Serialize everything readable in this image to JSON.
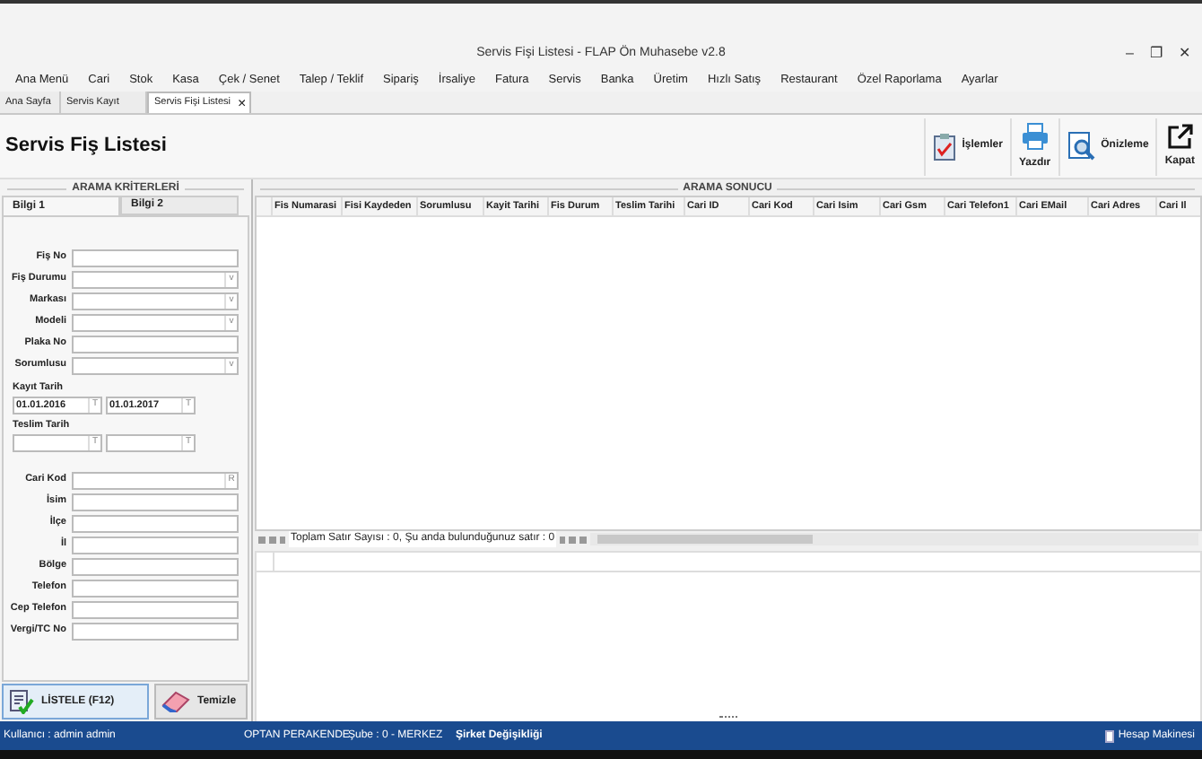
{
  "window": {
    "title": "Servis Fişi Listesi - FLAP Ön Muhasebe v2.8",
    "controls": [
      "–",
      "❐",
      "✕"
    ]
  },
  "menu": [
    "Ana Menü",
    "Cari",
    "Stok",
    "Kasa",
    "Çek / Senet",
    "Talep / Teklif",
    "Sipariş",
    "İrsaliye",
    "Fatura",
    "Servis",
    "Banka",
    "Üretim",
    "Hızlı Satış",
    "Restaurant",
    "Özel Raporlama",
    "Ayarlar"
  ],
  "tabs": [
    {
      "label": "Ana Sayfa",
      "selected": false
    },
    {
      "label": "Servis Kayıt",
      "selected": false
    },
    {
      "label": "Servis Fişi Listesi",
      "selected": true,
      "close": "×"
    }
  ],
  "page_title": "Servis Fiş Listesi",
  "toolbar": [
    {
      "kind": "side",
      "label": "İşlemler"
    },
    {
      "kind": "below",
      "label": "Yazdır"
    },
    {
      "kind": "side",
      "label": "Önizleme"
    },
    {
      "kind": "below",
      "label": "Kapat"
    }
  ],
  "criteria": {
    "title": "ARAMA KRİTERLERİ",
    "tabs": [
      {
        "label": "Bilgi 1",
        "selected": true
      },
      {
        "label": "Bilgi 2",
        "selected": false
      }
    ],
    "fields": [
      {
        "label": "Fiş No"
      },
      {
        "label": "Fiş Durumu",
        "button": "v"
      },
      {
        "label": "Markası",
        "button": "v"
      },
      {
        "label": "Modeli",
        "button": "v"
      },
      {
        "label": "Plaka No"
      },
      {
        "label": "Sorumlusu",
        "button": "v"
      }
    ],
    "date_groups": [
      {
        "label": "Kayıt Tarih",
        "dates": [
          {
            "value": "01.01.2016",
            "button": "T"
          },
          {
            "value": "01.01.2017",
            "button": "T"
          }
        ]
      },
      {
        "label": "Teslim Tarih",
        "dates": [
          {
            "button": "T"
          },
          {
            "button": "T"
          }
        ]
      }
    ],
    "cari_fields": [
      {
        "label": "Cari Kod",
        "button": "R"
      },
      {
        "label": "İsim"
      },
      {
        "label": "İlçe"
      },
      {
        "label": "İl"
      },
      {
        "label": "Bölge"
      },
      {
        "label": "Telefon"
      },
      {
        "label": "Cep Telefon"
      },
      {
        "label": "Vergi/TC No"
      }
    ],
    "buttons": [
      {
        "label": "LİSTELE (F12)"
      },
      {
        "label": "Temizle"
      }
    ]
  },
  "results": {
    "title": "ARAMA SONUCU",
    "columns": [
      "Fis Numarasi",
      "Fisi Kaydeden",
      "Sorumlusu",
      "Kayit Tarihi",
      "Fis Durum",
      "Teslim Tarihi",
      "Cari ID",
      "Cari Kod",
      "Cari Isim",
      "Cari Gsm",
      "Cari Telefon1",
      "Cari EMail",
      "Cari Adres",
      "Cari Il"
    ],
    "navigator": "Toplam Satır Sayısı : 0, Şu anda bulunduğunuz satır : 0"
  },
  "status_bar": {
    "user": "Kullanıcı : admin admin",
    "company": "OPTAN PERAKENDE",
    "branch": "Şube : 0 - MERKEZ",
    "switch": "Şirket Değişikliği",
    "calculator": "Hesap Makinesi"
  }
}
